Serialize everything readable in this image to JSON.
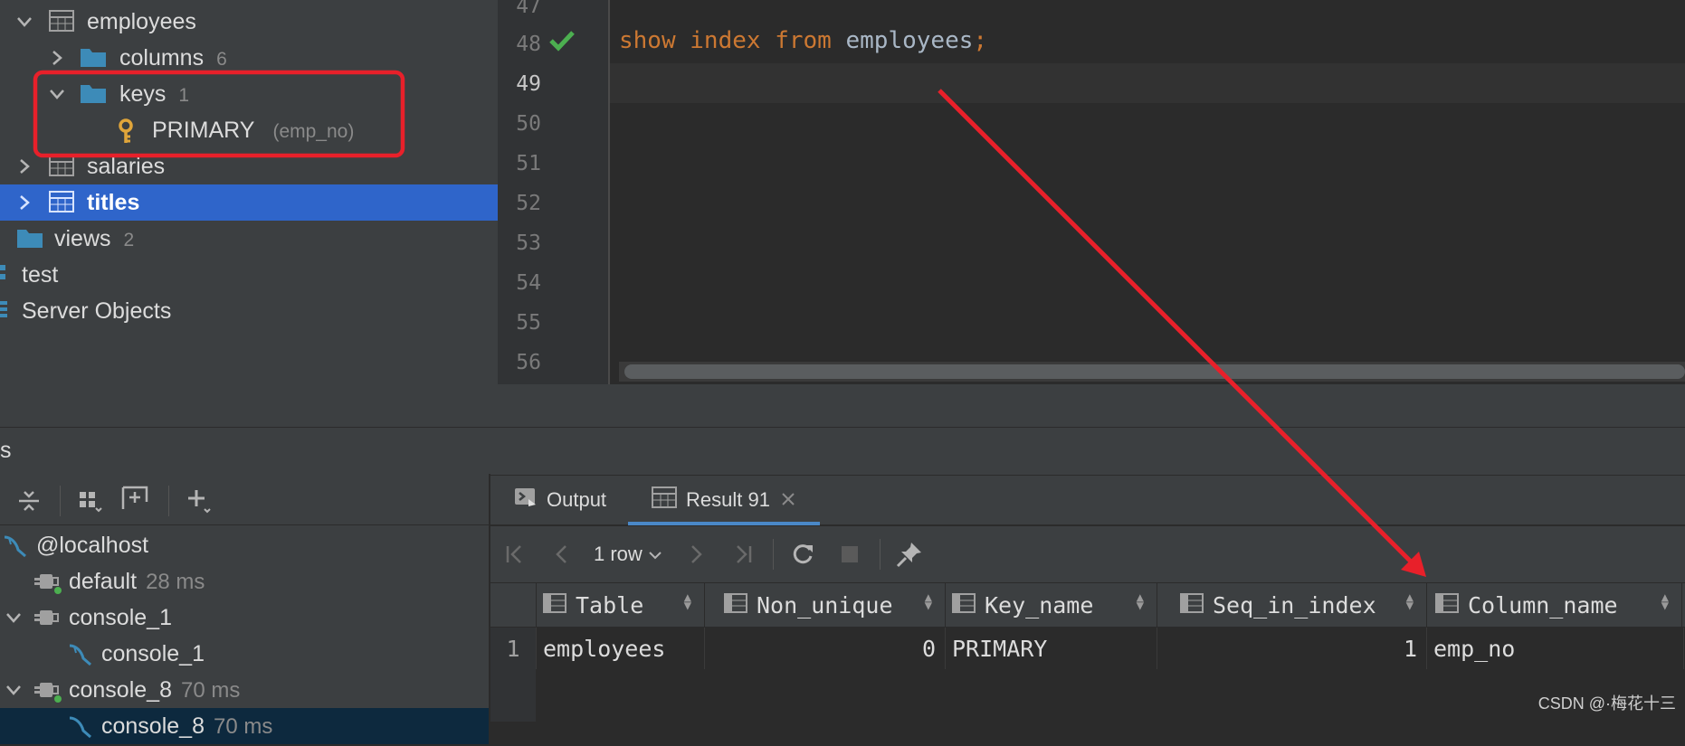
{
  "tree": {
    "employees": "employees",
    "columns": {
      "label": "columns",
      "count": "6"
    },
    "keys": {
      "label": "keys",
      "count": "1"
    },
    "primary": {
      "label": "PRIMARY",
      "column": "(emp_no)"
    },
    "salaries": "salaries",
    "titles": "titles",
    "views": {
      "label": "views",
      "count": "2"
    },
    "test": "test",
    "server_objects": "Server Objects"
  },
  "editor": {
    "line_numbers": [
      "47",
      "48",
      "49",
      "50",
      "51",
      "52",
      "53",
      "54",
      "55",
      "56"
    ],
    "code": {
      "kw1": "show",
      "kw2": "index",
      "kw3": "from",
      "ident": "employees",
      "semi": ";"
    }
  },
  "services": {
    "title": "s",
    "items": [
      {
        "label": "@localhost",
        "meta": ""
      },
      {
        "label": "default",
        "meta": "28 ms"
      },
      {
        "label": "console_1",
        "meta": ""
      },
      {
        "label": "console_1",
        "meta": ""
      },
      {
        "label": "console_8",
        "meta": "70 ms"
      },
      {
        "label": "console_8",
        "meta": "70 ms"
      }
    ]
  },
  "tabs": {
    "output": "Output",
    "result": "Result 91"
  },
  "result_toolbar": {
    "rows": "1 row"
  },
  "grid": {
    "columns": [
      "Table",
      "Non_unique",
      "Key_name",
      "Seq_in_index",
      "Column_name"
    ],
    "rows": [
      {
        "num": "1",
        "table": "employees",
        "non_unique": "0",
        "key_name": "PRIMARY",
        "seq_in_index": "1",
        "column_name": "emp_no"
      }
    ]
  },
  "colors": {
    "accent": "#2f65ca",
    "highlight": "#e8202a",
    "keyword": "#cc7832"
  },
  "watermark": "CSDN @·梅花十三"
}
